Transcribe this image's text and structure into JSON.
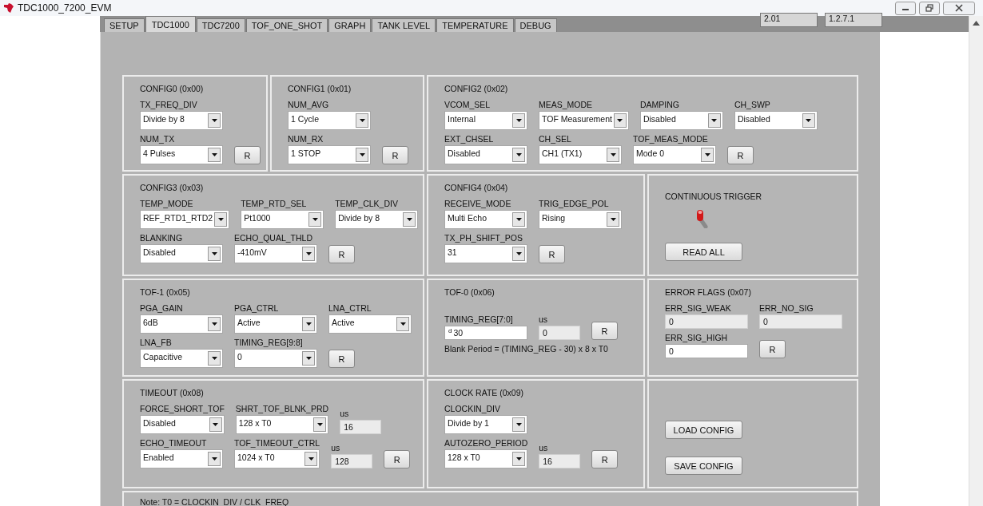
{
  "window": {
    "title": "TDC1000_7200_EVM"
  },
  "tabs": [
    {
      "label": "SETUP",
      "selected": false
    },
    {
      "label": "TDC1000",
      "selected": true
    },
    {
      "label": "TDC7200",
      "selected": false
    },
    {
      "label": "TOF_ONE_SHOT",
      "selected": false
    },
    {
      "label": "GRAPH",
      "selected": false
    },
    {
      "label": "TANK LEVEL",
      "selected": false
    },
    {
      "label": "TEMPERATURE",
      "selected": false
    },
    {
      "label": "DEBUG",
      "selected": false
    }
  ],
  "version_fields": [
    "2.01",
    "1.2.7.1"
  ],
  "panels": [
    {
      "title": "CONFIG0 (0x00)",
      "rows": [
        [
          {
            "kind": "combo",
            "label": "TX_FREQ_DIV",
            "value": "Divide by 8"
          }
        ],
        [
          {
            "kind": "combo",
            "label": "NUM_TX",
            "value": "4 Pulses"
          },
          {
            "kind": "button",
            "label": "R"
          }
        ]
      ]
    },
    {
      "title": "CONFIG1 (0x01)",
      "rows": [
        [
          {
            "kind": "combo",
            "label": "NUM_AVG",
            "value": "1 Cycle"
          }
        ],
        [
          {
            "kind": "combo",
            "label": "NUM_RX",
            "value": "1 STOP"
          },
          {
            "kind": "button",
            "label": "R"
          }
        ]
      ]
    },
    {
      "title": "CONFIG2 (0x02)",
      "rows": [
        [
          {
            "kind": "combo",
            "label": "VCOM_SEL",
            "value": "Internal"
          },
          {
            "kind": "combo",
            "label": "MEAS_MODE",
            "value": "TOF Measurement"
          },
          {
            "kind": "combo",
            "label": "DAMPING",
            "value": "Disabled"
          },
          {
            "kind": "combo",
            "label": "CH_SWP",
            "value": "Disabled"
          }
        ],
        [
          {
            "kind": "combo",
            "label": "EXT_CHSEL",
            "value": "Disabled"
          },
          {
            "kind": "combo",
            "label": "CH_SEL",
            "value": "CH1 (TX1)"
          },
          {
            "kind": "combo",
            "label": "TOF_MEAS_MODE",
            "value": "Mode 0"
          },
          {
            "kind": "button",
            "label": "R"
          }
        ]
      ]
    },
    {
      "title": "CONFIG3 (0x03)",
      "rows": [
        [
          {
            "kind": "combo",
            "label": "TEMP_MODE",
            "value": "REF_RTD1_RTD2"
          },
          {
            "kind": "combo",
            "label": "TEMP_RTD_SEL",
            "value": "Pt1000"
          },
          {
            "kind": "combo",
            "label": "TEMP_CLK_DIV",
            "value": "Divide by 8"
          }
        ],
        [
          {
            "kind": "combo",
            "label": "BLANKING",
            "value": "Disabled"
          },
          {
            "kind": "combo",
            "label": "ECHO_QUAL_THLD",
            "value": "-410mV"
          },
          {
            "kind": "button",
            "label": "R"
          }
        ]
      ]
    },
    {
      "title": "CONFIG4 (0x04)",
      "rows": [
        [
          {
            "kind": "combo",
            "label": "RECEIVE_MODE",
            "value": "Multi Echo"
          },
          {
            "kind": "combo",
            "label": "TRIG_EDGE_POL",
            "value": "Rising"
          }
        ],
        [
          {
            "kind": "combo",
            "label": "TX_PH_SHIFT_POS",
            "value": "31"
          },
          {
            "kind": "button",
            "label": "R"
          }
        ]
      ]
    },
    {
      "rows": [
        [
          {
            "kind": "toggle",
            "label": "CONTINUOUS TRIGGER"
          }
        ],
        [
          {
            "kind": "wide_button",
            "label": "READ ALL"
          }
        ]
      ]
    },
    {
      "title": "TOF-1 (0x05)",
      "rows": [
        [
          {
            "kind": "combo",
            "label": "PGA_GAIN",
            "value": "6dB"
          },
          {
            "kind": "combo",
            "label": "PGA_CTRL",
            "value": "Active"
          },
          {
            "kind": "combo",
            "label": "LNA_CTRL",
            "value": "Active"
          }
        ],
        [
          {
            "kind": "combo",
            "label": "LNA_FB",
            "value": "Capacitive"
          },
          {
            "kind": "combo",
            "label": "TIMING_REG[9:8]",
            "value": "0"
          },
          {
            "kind": "button",
            "label": "R"
          }
        ]
      ]
    },
    {
      "title": "TOF-0 (0x06)",
      "rows": [
        [
          {
            "kind": "input",
            "label": "TIMING_REG[7:0]",
            "radix": "d",
            "value": "30",
            "readonly": false
          },
          {
            "kind": "reading",
            "label": "us",
            "value": "0"
          },
          {
            "kind": "button",
            "label": "R"
          }
        ],
        [
          {
            "kind": "text",
            "value": "Blank Period = (TIMING_REG - 30) x 8 x T0"
          }
        ]
      ]
    },
    {
      "title": "ERROR FLAGS (0x07)",
      "rows": [
        [
          {
            "kind": "input",
            "label": "ERR_SIG_WEAK",
            "value": "0",
            "readonly": true
          },
          {
            "kind": "input",
            "label": "ERR_NO_SIG",
            "value": "0",
            "readonly": true
          }
        ],
        [
          {
            "kind": "input",
            "label": "ERR_SIG_HIGH",
            "value": "0",
            "readonly": false
          },
          {
            "kind": "button",
            "label": "R"
          }
        ]
      ]
    },
    {
      "title": "TIMEOUT (0x08)",
      "rows": [
        [
          {
            "kind": "combo",
            "label": "FORCE_SHORT_TOF",
            "value": "Disabled"
          },
          {
            "kind": "combo",
            "label": "SHRT_TOF_BLNK_PRD",
            "value": "128 x T0"
          },
          {
            "kind": "reading",
            "label": "us",
            "value": "16"
          }
        ],
        [
          {
            "kind": "combo",
            "label": "ECHO_TIMEOUT",
            "value": "Enabled"
          },
          {
            "kind": "combo",
            "label": "TOF_TIMEOUT_CTRL",
            "value": "1024 x T0"
          },
          {
            "kind": "reading",
            "label": "us",
            "value": "128"
          },
          {
            "kind": "button",
            "label": "R"
          }
        ]
      ]
    },
    {
      "title": "CLOCK RATE (0x09)",
      "rows": [
        [
          {
            "kind": "combo",
            "label": "CLOCKIN_DIV",
            "value": "Divide by 1"
          }
        ],
        [
          {
            "kind": "combo",
            "label": "AUTOZERO_PERIOD",
            "value": "128 x T0"
          },
          {
            "kind": "reading",
            "label": "us",
            "value": "16"
          },
          {
            "kind": "button",
            "label": "R"
          }
        ]
      ]
    },
    {
      "rows": [
        [
          {
            "kind": "wide_button",
            "label": "LOAD CONFIG"
          }
        ],
        [
          {
            "kind": "wide_button",
            "label": "SAVE CONFIG"
          }
        ]
      ]
    }
  ],
  "note": "Note: T0 = CLOCKIN_DIV / CLK_FREQ"
}
